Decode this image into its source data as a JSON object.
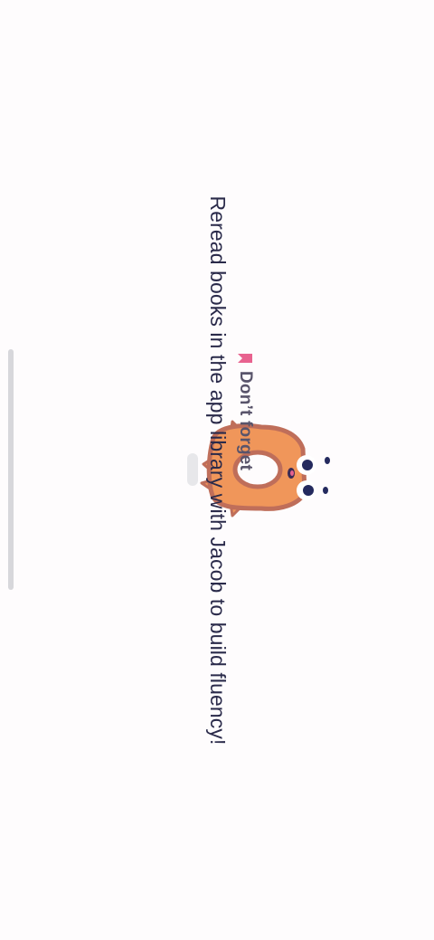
{
  "reminder": {
    "label": "Don’t forget",
    "icon": "bookmark-icon",
    "icon_color": "#e8628f"
  },
  "message": {
    "text": "Reread books in the app library with Jacob to build fluency!"
  },
  "mascot": {
    "name": "mascot-character",
    "body_color": "#f0965a",
    "outline_color": "#bf6e5a",
    "eye_color": "#242a5e"
  },
  "colors": {
    "background": "#fefcfd",
    "scrollbar": "#d7d7db",
    "text_primary": "#2a2a4a",
    "text_secondary": "#59546b"
  }
}
